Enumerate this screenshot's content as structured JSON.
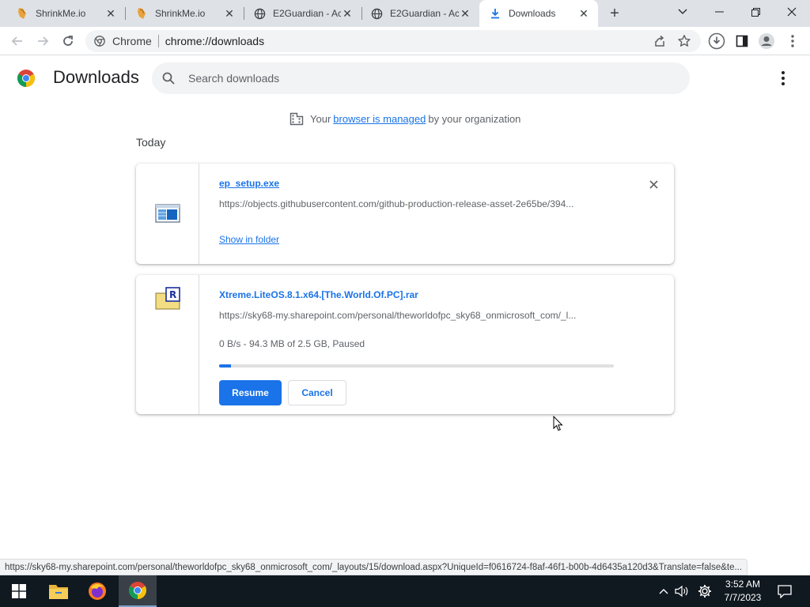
{
  "tabs": [
    {
      "title": "ShrinkMe.io",
      "icon": "shrinkme-icon",
      "active": false
    },
    {
      "title": "ShrinkMe.io",
      "icon": "shrinkme-icon",
      "active": false
    },
    {
      "title": "E2Guardian - Ac",
      "icon": "globe-icon",
      "active": false
    },
    {
      "title": "E2Guardian - Ac",
      "icon": "globe-icon",
      "active": false
    },
    {
      "title": "Downloads",
      "icon": "download-icon",
      "active": true
    }
  ],
  "omnibox": {
    "site": "Chrome",
    "url": "chrome://downloads"
  },
  "header": {
    "title": "Downloads",
    "search_placeholder": "Search downloads"
  },
  "managed": {
    "before": "Your",
    "link": "browser is managed",
    "after": "by your organization"
  },
  "section_label": "Today",
  "downloads": [
    {
      "name": "ep_setup.exe",
      "url": "https://objects.githubusercontent.com/github-production-release-asset-2e65be/394...",
      "action": "Show in folder",
      "icon": "exe-file-icon"
    },
    {
      "name": "Xtreme.LiteOS.8.1.x64.[The.World.Of.PC].rar",
      "url": "https://sky68-my.sharepoint.com/personal/theworldofpc_sky68_onmicrosoft_com/_l...",
      "status": "0 B/s - 94.3 MB of 2.5 GB, Paused",
      "progress_fraction": 0.03,
      "resume_label": "Resume",
      "cancel_label": "Cancel",
      "icon": "rar-file-icon"
    }
  ],
  "status_bar_url": "https://sky68-my.sharepoint.com/personal/theworldofpc_sky68_onmicrosoft_com/_layouts/15/download.aspx?UniqueId=f0616724-f8af-46f1-b00b-4d6435a120d3&Translate=false&te...",
  "clock": {
    "time": "3:52 AM",
    "date": "7/7/2023"
  },
  "colors": {
    "accent": "#1a73e8",
    "tabstrip": "#dee1e6",
    "taskbar": "#101820"
  }
}
